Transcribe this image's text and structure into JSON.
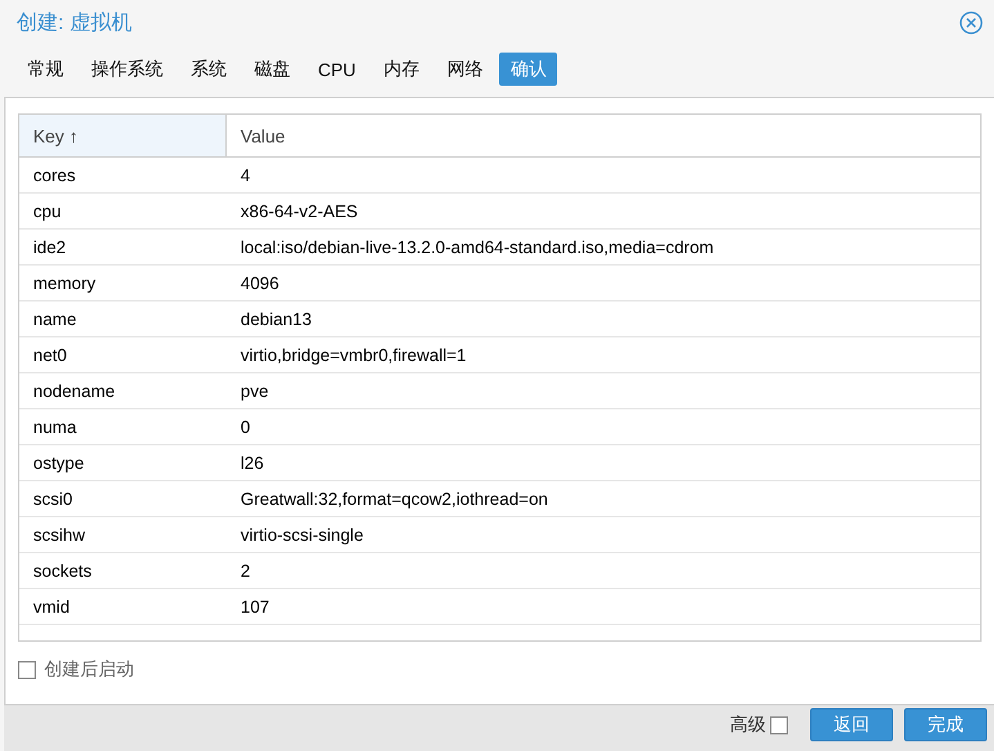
{
  "window": {
    "title": "创建: 虚拟机"
  },
  "tabs": [
    {
      "label": "常规",
      "selected": false
    },
    {
      "label": "操作系统",
      "selected": false
    },
    {
      "label": "系统",
      "selected": false
    },
    {
      "label": "磁盘",
      "selected": false
    },
    {
      "label": "CPU",
      "selected": false
    },
    {
      "label": "内存",
      "selected": false
    },
    {
      "label": "网络",
      "selected": false
    },
    {
      "label": "确认",
      "selected": true
    }
  ],
  "table": {
    "columns": [
      {
        "label": "Key",
        "sort": "↑"
      },
      {
        "label": "Value"
      }
    ],
    "rows": [
      [
        "cores",
        "4"
      ],
      [
        "cpu",
        "x86-64-v2-AES"
      ],
      [
        "ide2",
        "local:iso/debian-live-13.2.0-amd64-standard.iso,media=cdrom"
      ],
      [
        "memory",
        "4096"
      ],
      [
        "name",
        "debian13"
      ],
      [
        "net0",
        "virtio,bridge=vmbr0,firewall=1"
      ],
      [
        "nodename",
        "pve"
      ],
      [
        "numa",
        "0"
      ],
      [
        "ostype",
        "l26"
      ],
      [
        "scsi0",
        "Greatwall:32,format=qcow2,iothread=on"
      ],
      [
        "scsihw",
        "virtio-scsi-single"
      ],
      [
        "sockets",
        "2"
      ],
      [
        "vmid",
        "107"
      ]
    ]
  },
  "start_after_create": {
    "label": "创建后启动",
    "checked": false
  },
  "footer": {
    "advanced": {
      "label": "高级",
      "checked": false
    },
    "buttons": [
      "返回",
      "完成"
    ]
  }
}
